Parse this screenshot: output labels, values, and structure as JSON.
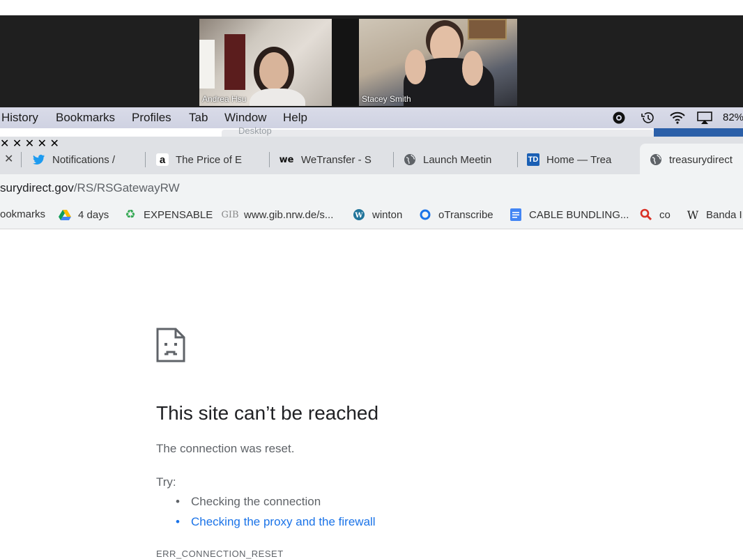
{
  "video_call": {
    "participants": [
      {
        "name": "Andrea Hsu"
      },
      {
        "name": "Stacey Smith"
      }
    ]
  },
  "menubar": {
    "items": [
      "History",
      "Bookmarks",
      "Profiles",
      "Tab",
      "Window",
      "Help"
    ],
    "battery": "82%"
  },
  "desktop_label": "Desktop",
  "tabs": [
    {
      "title": "Notifications /",
      "icon": "twitter-icon"
    },
    {
      "title": "The Price of E",
      "icon": "amazon-icon"
    },
    {
      "title": "WeTransfer - S",
      "icon": "wetransfer-icon"
    },
    {
      "title": "Launch Meetin",
      "icon": "globe-icon"
    },
    {
      "title": "Home — Trea",
      "icon": "td-icon"
    },
    {
      "title": "treasurydirect",
      "icon": "globe-icon"
    }
  ],
  "address_bar": {
    "host": "surydirect.gov",
    "path": "/RS/RSGatewayRW"
  },
  "bookmarks": [
    {
      "label": "ookmarks"
    },
    {
      "label": "4 days",
      "icon": "google-drive-icon"
    },
    {
      "label": "EXPENSABLE",
      "icon": "recycle-icon"
    },
    {
      "label": "www.gib.nrw.de/s...",
      "icon": "gib-icon"
    },
    {
      "label": "winton",
      "icon": "wordpress-icon"
    },
    {
      "label": "oTranscribe",
      "icon": "otranscribe-icon"
    },
    {
      "label": "CABLE BUNDLING...",
      "icon": "google-docs-icon"
    },
    {
      "label": "co",
      "icon": "search-icon"
    },
    {
      "label": "Banda I",
      "icon": "wikipedia-icon"
    }
  ],
  "error_page": {
    "title": "This site can’t be reached",
    "message": "The connection was reset.",
    "try_label": "Try:",
    "suggestions": [
      {
        "text": "Checking the connection",
        "link": false
      },
      {
        "text": "Checking the proxy and the firewall",
        "link": true
      }
    ],
    "error_code": "ERR_CONNECTION_RESET"
  },
  "colors": {
    "link": "#1a73e8",
    "menubar_bg": "#d5d8e6",
    "tabbar_bg": "#dfe1e5"
  }
}
